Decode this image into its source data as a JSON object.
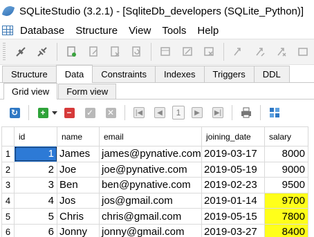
{
  "window": {
    "title": "SQLiteStudio (3.2.1) - [SqliteDb_developers (SQLite_Python)]"
  },
  "menu": {
    "items": [
      "Database",
      "Structure",
      "View",
      "Tools",
      "Help"
    ]
  },
  "main_toolbar": {
    "icons": [
      "connect-icon",
      "disconnect-icon",
      "add-database-icon",
      "edit-database-icon",
      "delete-database-icon",
      "refresh-icon",
      "add-table-icon",
      "edit-table-icon",
      "delete-table-icon",
      "add-index-icon",
      "edit-index-icon",
      "delete-index-icon",
      "add-trigger-icon"
    ]
  },
  "tabs": {
    "items": [
      "Structure",
      "Data",
      "Constraints",
      "Indexes",
      "Triggers",
      "DDL"
    ],
    "active": "Data"
  },
  "subtabs": {
    "items": [
      "Grid view",
      "Form view"
    ],
    "active": "Grid view"
  },
  "grid_toolbar": {
    "page": "1"
  },
  "grid": {
    "columns": [
      "id",
      "name",
      "email",
      "joining_date",
      "salary"
    ],
    "rows": [
      {
        "rownum": "1",
        "id": "1",
        "name": "James",
        "email": "james@pynative.com",
        "joining_date": "2019-03-17",
        "salary": "8000"
      },
      {
        "rownum": "2",
        "id": "2",
        "name": "Joe",
        "email": "joe@pynative.com",
        "joining_date": "2019-05-19",
        "salary": "9000"
      },
      {
        "rownum": "3",
        "id": "3",
        "name": "Ben",
        "email": "ben@pynative.com",
        "joining_date": "2019-02-23",
        "salary": "9500"
      },
      {
        "rownum": "4",
        "id": "4",
        "name": "Jos",
        "email": "jos@gmail.com",
        "joining_date": "2019-01-14",
        "salary": "9700"
      },
      {
        "rownum": "5",
        "id": "5",
        "name": "Chris",
        "email": "chris@gmail.com",
        "joining_date": "2019-05-15",
        "salary": "7800"
      },
      {
        "rownum": "6",
        "id": "6",
        "name": "Jonny",
        "email": "jonny@gmail.com",
        "joining_date": "2019-03-27",
        "salary": "8400"
      }
    ],
    "highlight_color": "#ffff1a",
    "selection_color": "#2d7ad6"
  }
}
